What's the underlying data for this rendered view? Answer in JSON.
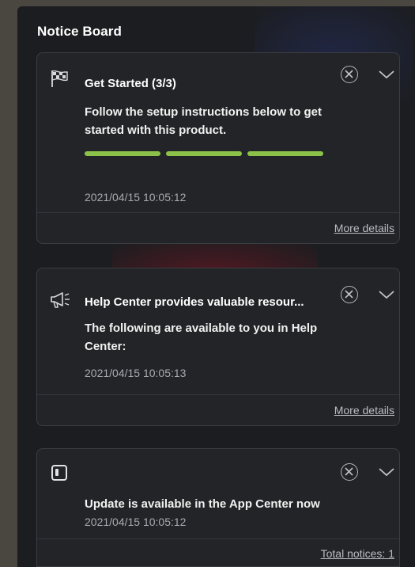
{
  "notice_board": {
    "title": "Notice Board"
  },
  "notices": [
    {
      "icon": "checkered-flag-icon",
      "title": "Get Started (3/3)",
      "text": "Follow the setup instructions below to get started with this product.",
      "progress": {
        "completed": 3,
        "total": 3
      },
      "timestamp": "2021/04/15 10:05:12",
      "link": "More details"
    },
    {
      "icon": "megaphone-icon",
      "title": "Help Center provides valuable resour...",
      "text": "The following are available to you in Help Center:",
      "timestamp": "2021/04/15 10:05:13",
      "link": "More details"
    },
    {
      "icon": "app-window-icon",
      "title": "",
      "text": "Update is available in the App Center now",
      "timestamp": "2021/04/15 10:05:12",
      "link": "Total notices: 1"
    }
  ],
  "colors": {
    "progress": "#8bc34a",
    "card_background": "#222427"
  }
}
